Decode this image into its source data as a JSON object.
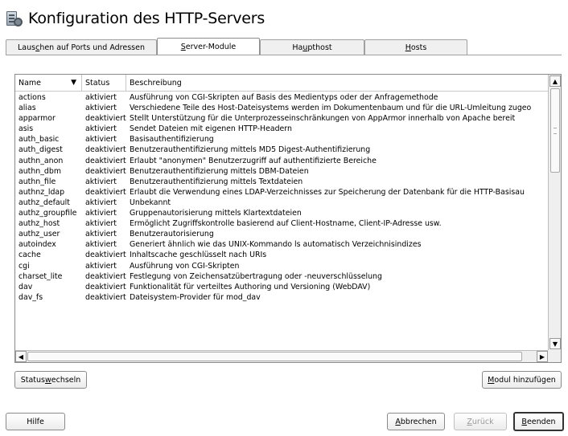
{
  "window": {
    "title": "Konfiguration des HTTP-Servers"
  },
  "tabs": [
    {
      "pre": "Laus",
      "mn": "c",
      "post": "hen auf Ports und Adressen"
    },
    {
      "pre": "",
      "mn": "S",
      "post": "erver-Module"
    },
    {
      "pre": "Ha",
      "mn": "u",
      "post": "pthost"
    },
    {
      "pre": "",
      "mn": "H",
      "post": "osts"
    }
  ],
  "table": {
    "headers": {
      "name": "Name",
      "status": "Status",
      "description": "Beschreibung"
    },
    "rows": [
      {
        "name": "actions",
        "status": "aktiviert",
        "desc": "Ausführung von CGI-Skripten auf Basis des Medientyps oder der Anfragemethode"
      },
      {
        "name": "alias",
        "status": "aktiviert",
        "desc": "Verschiedene Teile des Host-Dateisystems werden im Dokumentenbaum und für die URL-Umleitung zugeo"
      },
      {
        "name": "apparmor",
        "status": "deaktiviert",
        "desc": "Stellt Unterstützung für die Unterprozesseinschränkungen von AppArmor innerhalb von Apache bereit"
      },
      {
        "name": "asis",
        "status": "aktiviert",
        "desc": "Sendet Dateien mit eigenen HTTP-Headern"
      },
      {
        "name": "auth_basic",
        "status": "aktiviert",
        "desc": "Basisauthentifizierung"
      },
      {
        "name": "auth_digest",
        "status": "deaktiviert",
        "desc": "Benutzerauthentifizierung mittels MD5 Digest-Authentifizierung"
      },
      {
        "name": "authn_anon",
        "status": "deaktiviert",
        "desc": "Erlaubt \"anonymen\" Benutzerzugriff auf authentifizierte Bereiche"
      },
      {
        "name": "authn_dbm",
        "status": "deaktiviert",
        "desc": "Benutzerauthentifizierung mittels DBM-Dateien"
      },
      {
        "name": "authn_file",
        "status": "aktiviert",
        "desc": "Benutzerauthentifizierung mittels Textdateien"
      },
      {
        "name": "authnz_ldap",
        "status": "deaktiviert",
        "desc": "Erlaubt die Verwendung eines LDAP-Verzeichnisses zur Speicherung der Datenbank für die HTTP-Basisau"
      },
      {
        "name": "authz_default",
        "status": "aktiviert",
        "desc": "Unbekannt"
      },
      {
        "name": "authz_groupfile",
        "status": "aktiviert",
        "desc": "Gruppenautorisierung mittels Klartextdateien"
      },
      {
        "name": "authz_host",
        "status": "aktiviert",
        "desc": "Ermöglicht Zugriffskontrolle basierend auf Client-Hostname, Client-IP-Adresse usw."
      },
      {
        "name": "authz_user",
        "status": "aktiviert",
        "desc": "Benutzerautorisierung"
      },
      {
        "name": "autoindex",
        "status": "aktiviert",
        "desc": "Generiert ähnlich wie das UNIX-Kommando ls automatisch Verzeichnisindizes"
      },
      {
        "name": "cache",
        "status": "deaktiviert",
        "desc": "Inhaltscache geschlüsselt nach URIs"
      },
      {
        "name": "cgi",
        "status": "aktiviert",
        "desc": "Ausführung von CGI-Skripten"
      },
      {
        "name": "charset_lite",
        "status": "deaktiviert",
        "desc": "Festlegung von Zeichensatzübertragung oder -neuverschlüsselung"
      },
      {
        "name": "dav",
        "status": "deaktiviert",
        "desc": "Funktionalität für verteiltes Authoring und Versioning (WebDAV)"
      },
      {
        "name": "dav_fs",
        "status": "deaktiviert",
        "desc": "Dateisystem-Provider für mod_dav"
      }
    ]
  },
  "buttons": {
    "status_toggle": {
      "pre": "Status ",
      "mn": "w",
      "post": "echseln"
    },
    "add_module": {
      "pre": "",
      "mn": "M",
      "post": "odul hinzufügen"
    },
    "help": {
      "pre": "Hilfe",
      "mn": "",
      "post": ""
    },
    "cancel": {
      "pre": "",
      "mn": "A",
      "post": "bbrechen"
    },
    "back": {
      "pre": "",
      "mn": "Z",
      "post": "urück"
    },
    "finish": {
      "pre": "",
      "mn": "B",
      "post": "eenden"
    }
  },
  "icons": {
    "title": "server-config-icon",
    "sort": "sort-desc-icon",
    "scroll_up": "arrow-up-icon",
    "scroll_down": "arrow-down-icon",
    "scroll_left": "arrow-left-icon",
    "scroll_right": "arrow-right-icon"
  }
}
